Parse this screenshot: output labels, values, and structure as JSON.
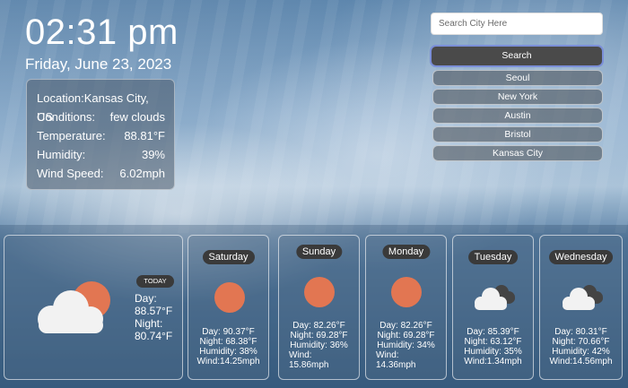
{
  "clock": {
    "time": "02:31 pm",
    "date": "Friday, June 23, 2023"
  },
  "current": {
    "rows": [
      {
        "label": "Location:Kansas City, US",
        "value": ""
      },
      {
        "label": "Conditions:",
        "value": "few clouds"
      },
      {
        "label": "Temperature:",
        "value": "88.81°F"
      },
      {
        "label": "Humidity:",
        "value": "39%"
      },
      {
        "label": "Wind Speed:",
        "value": "6.02mph"
      }
    ]
  },
  "search": {
    "placeholder": "Search City Here",
    "button_label": "Search"
  },
  "cities": [
    "Seoul",
    "New York",
    "Austin",
    "Bristol",
    "Kansas City"
  ],
  "today": {
    "badge": "TODAY",
    "day_label": "Day:",
    "day_value": "88.57°F",
    "night_label": "Night:",
    "night_value": "80.74°F",
    "icon": "partly-cloudy-icon"
  },
  "forecast": [
    {
      "day": "Saturday",
      "icon": "sun-icon",
      "line1": "Day: 90.37°F",
      "line2": "Night: 68.38°F",
      "line3": "Humidity: 38%",
      "line4": "Wind:14.25mph",
      "line5": ""
    },
    {
      "day": "Sunday",
      "icon": "sun-icon",
      "line1": "Day: 82.26°F",
      "line2": "Night: 69.28°F",
      "line3": "Humidity: 36%",
      "line4": "Wind:",
      "line5": "15.86mph"
    },
    {
      "day": "Monday",
      "icon": "sun-icon",
      "line1": "Day: 82.26°F",
      "line2": "Night: 69.28°F",
      "line3": "Humidity: 34%",
      "line4": "Wind:",
      "line5": "14.36mph"
    },
    {
      "day": "Tuesday",
      "icon": "cloudy-icon",
      "line1": "Day: 85.39°F",
      "line2": "Night: 63.12°F",
      "line3": "Humidity: 35%",
      "line4": "Wind:1.34mph",
      "line5": ""
    },
    {
      "day": "Wednesday",
      "icon": "cloudy-icon",
      "line1": "Day: 80.31°F",
      "line2": "Night: 70.66°F",
      "line3": "Humidity: 42%",
      "line4": "Wind:14.56mph",
      "line5": ""
    }
  ],
  "colors": {
    "sun": "#e27652",
    "pill": "#3a3a3a",
    "search_button": "#4a4a4a",
    "search_focus": "#7b8fd8"
  }
}
